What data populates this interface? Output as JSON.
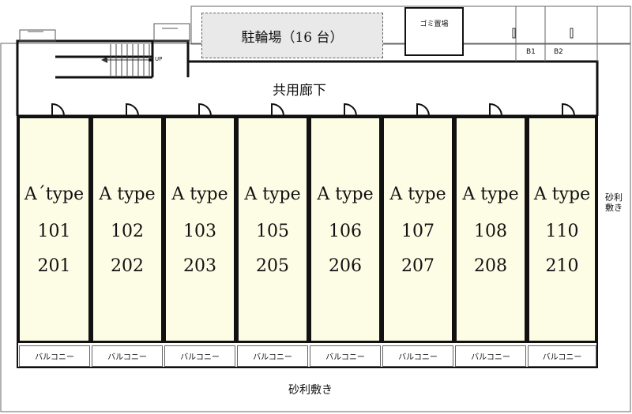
{
  "plan": {
    "corridor_label": "共用廊下",
    "parking_label": "駐輪場（16 台）",
    "garbage_label": "ゴミ置場",
    "storage": [
      "B1",
      "B2"
    ],
    "stair_label": "UP",
    "gravel_bottom": "砂利敷き",
    "gravel_right": "砂利敷き",
    "balcony_label": "バルコニー",
    "units": [
      {
        "type": "A´type",
        "lower": "101",
        "upper": "201"
      },
      {
        "type": "A type",
        "lower": "102",
        "upper": "202"
      },
      {
        "type": "A type",
        "lower": "103",
        "upper": "203"
      },
      {
        "type": "A type",
        "lower": "105",
        "upper": "205"
      },
      {
        "type": "A type",
        "lower": "106",
        "upper": "206"
      },
      {
        "type": "A type",
        "lower": "107",
        "upper": "207"
      },
      {
        "type": "A type",
        "lower": "108",
        "upper": "208"
      },
      {
        "type": "A type",
        "lower": "110",
        "upper": "210"
      }
    ]
  },
  "colors": {
    "unit_fill": "#fdfde6",
    "wall": "#111111",
    "parking_fill": "#e9e9e9"
  }
}
